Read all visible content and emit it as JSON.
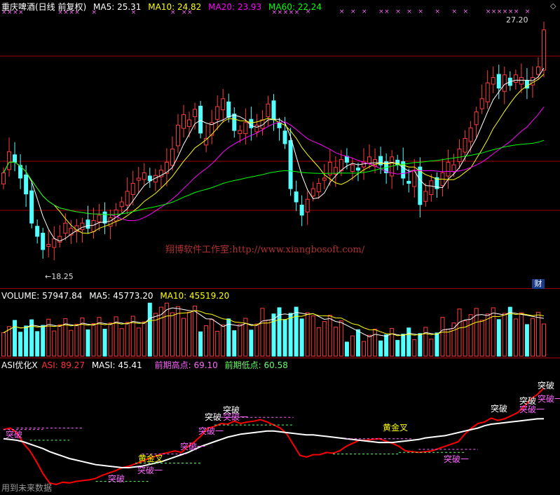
{
  "header": {
    "stock": "重庆啤酒(日线 前复权)",
    "ma5": "MA5: 25.31",
    "ma10": "MA10: 24.82",
    "ma20": "MA20: 23.93",
    "ma60": "MA60: 22.24"
  },
  "volume_header": {
    "volume": "VOLUME: 57947.84",
    "ma5": "MA5: 45773.20",
    "ma10": "MA10: 45519.20"
  },
  "asi_header": {
    "name": "ASI优化X",
    "asi": "ASI: 89.27",
    "masi": "MASI: 45.41",
    "prev_high": "前期高点: 69.10",
    "prev_low": "前期低点: 60.58"
  },
  "annotations": {
    "high": "27.20",
    "low": "←18.25",
    "badge": "财",
    "diamond": "◇",
    "watermark": "翔博软件工作室:http://www.xiangbosoft.com/",
    "future_note": "用到未来数据"
  },
  "signals": [
    {
      "text": "突破",
      "color": "#ff66ff"
    },
    {
      "text": "突破一",
      "color": "#ff66ff"
    },
    {
      "text": "突破",
      "color": "#ff66ff"
    },
    {
      "text": "黄金叉",
      "color": "#ffff00"
    },
    {
      "text": "突破一",
      "color": "#ff66ff"
    },
    {
      "text": "突破一",
      "color": "#ff66ff"
    },
    {
      "text": "突破",
      "color": "#ffffff"
    },
    {
      "text": "突破",
      "color": "#ffffff"
    },
    {
      "text": "突破一",
      "color": "#ff66ff"
    },
    {
      "text": "黄金叉",
      "color": "#ffff00"
    },
    {
      "text": "突破一",
      "color": "#ff66ff"
    },
    {
      "text": "突破",
      "color": "#ffffff"
    },
    {
      "text": "突破",
      "color": "#ffffff"
    },
    {
      "text": "突破一",
      "color": "#ff66ff"
    },
    {
      "text": "突破",
      "color": "#ffffff"
    },
    {
      "text": "突破一",
      "color": "#ff66ff"
    }
  ],
  "colors": {
    "up": "#ff3b3b",
    "down": "#54ffff",
    "ma5": "#ffffff",
    "ma10": "#ffff00",
    "ma20": "#ff00ff",
    "ma60": "#00ff00",
    "asi": "#ff0000",
    "masi": "#ffffff",
    "grid": "#a00000"
  },
  "chart_data": {
    "type": "candlestick",
    "price_range": [
      18.25,
      27.2
    ],
    "close": [
      21.8,
      22.6,
      22.2,
      21.6,
      21.0,
      19.9,
      19.4,
      18.9,
      19.1,
      19.3,
      19.4,
      19.9,
      19.7,
      19.8,
      19.9,
      19.7,
      20.0,
      20.2,
      19.9,
      20.1,
      20.4,
      20.7,
      21.1,
      21.4,
      21.6,
      21.8,
      21.5,
      21.7,
      21.9,
      22.2,
      22.7,
      23.6,
      24.0,
      23.8,
      24.2,
      23.3,
      23.1,
      23.7,
      24.3,
      24.6,
      23.9,
      23.4,
      23.4,
      23.7,
      23.5,
      23.6,
      23.8,
      24.4,
      23.8,
      23.5,
      22.9,
      21.2,
      20.7,
      20.2,
      20.8,
      21.2,
      21.4,
      21.6,
      22.2,
      22.0,
      22.3,
      22.2,
      22.1,
      21.9,
      22.2,
      22.4,
      22.3,
      22.1,
      21.8,
      22.4,
      22.1,
      21.6,
      21.4,
      21.9,
      20.6,
      21.1,
      21.5,
      21.2,
      21.8,
      22.2,
      22.1,
      22.7,
      23.1,
      23.5,
      24.1,
      24.6,
      25.2,
      25.4,
      25.0,
      25.5,
      25.1,
      25.5,
      25.4,
      25.0,
      25.4,
      25.8,
      27.2
    ],
    "asi": [
      62.0,
      63.0,
      60.0,
      53.0,
      48.0,
      41.0,
      33.0,
      27.0,
      26.0,
      27.5,
      27.0,
      28.0,
      28.5,
      29.0,
      30.0,
      32.0,
      33.5,
      35.0,
      37.0,
      38.0,
      39.5,
      41.0,
      43.0,
      44.5,
      46.0,
      47.0,
      48.0,
      47.0,
      51.0,
      54.0,
      58.0,
      63.0,
      64.0,
      66.0,
      65.5,
      67.5,
      66.0,
      67.0,
      67.5,
      68.5,
      67.0,
      65.0,
      63.0,
      59.0,
      52.0,
      45.0,
      44.0,
      45.5,
      45.5,
      47.0,
      46.5,
      48.0,
      51.0,
      53.0,
      55.0,
      55.0,
      55.5,
      56.0,
      54.5,
      53.0,
      51.0,
      48.0,
      47.5,
      47.0,
      47.5,
      48.0,
      49.5,
      51.0,
      52.5,
      54.0,
      59.0,
      63.0,
      66.0,
      67.0,
      69.5,
      68.0,
      69.0,
      71.0,
      73.0,
      77.0,
      82.0,
      85.0,
      89.27
    ],
    "masi": [
      56.0,
      55.5,
      55.0,
      54.0,
      52.5,
      51.0,
      49.5,
      47.5,
      46.0,
      44.5,
      43.0,
      42.0,
      41.0,
      40.0,
      39.0,
      38.5,
      38.0,
      37.5,
      37.0,
      37.0,
      37.5,
      38.0,
      39.0,
      40.0,
      41.0,
      42.5,
      44.0,
      45.5,
      47.0,
      49.0,
      51.0,
      52.5,
      54.0,
      55.5,
      57.0,
      58.0,
      59.0,
      59.5,
      60.0,
      60.5,
      61.0,
      61.0,
      60.5,
      60.0,
      59.5,
      59.0,
      58.5,
      58.5,
      58.0,
      57.5,
      57.0,
      56.5,
      56.0,
      55.5,
      55.0,
      54.5,
      54.0,
      53.5,
      53.5,
      53.5,
      54.0,
      54.5,
      55.0,
      55.5,
      56.5,
      57.0,
      57.5,
      58.0,
      59.0,
      60.0,
      61.0,
      62.0,
      63.0,
      64.5,
      65.5,
      66.0,
      66.5,
      67.0,
      67.5,
      68.0,
      68.5,
      69.0,
      69.1
    ],
    "asi_range": [
      20,
      100
    ]
  }
}
